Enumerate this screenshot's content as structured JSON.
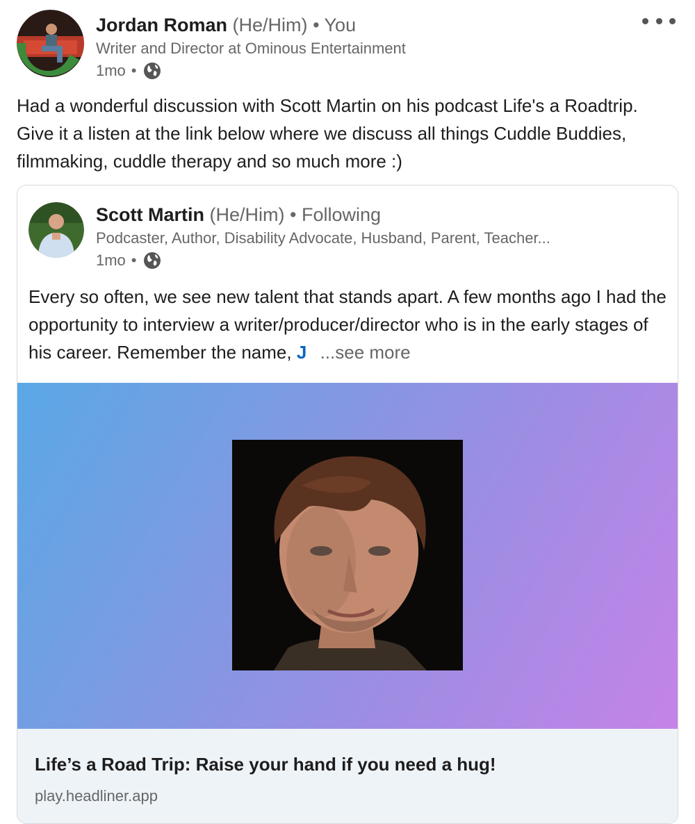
{
  "author": {
    "name": "Jordan Roman",
    "pronouns": "(He/Him)",
    "separator": "•",
    "relation": "You",
    "headline": "Writer and Director at Ominous Entertainment",
    "time": "1mo",
    "time_separator": "•",
    "visibility_icon": "globe-icon",
    "avatar_badge": "#OPENTOWORK"
  },
  "post": {
    "text": "Had a wonderful discussion with Scott Martin on his podcast Life's a Roadtrip. Give it a listen at the link below where we discuss all things Cuddle Buddies, filmmaking, cuddle therapy and so much more :)"
  },
  "shared": {
    "author": {
      "name": "Scott Martin",
      "pronouns": "(He/Him)",
      "separator": "•",
      "relation": "Following",
      "headline": "Podcaster, Author, Disability Advocate, Husband, Parent, Teacher...",
      "time": "1mo",
      "time_separator": "•"
    },
    "text": "Every so often, we see new talent that stands apart. A few months ago I had the opportunity to interview a writer/producer/director who is in the early stages of his career. Remember the name,",
    "mention": "J",
    "see_more": "...see more"
  },
  "link": {
    "title": "Life’s a Road Trip: Raise your hand if you need a hug!",
    "domain": "play.headliner.app"
  },
  "colors": {
    "accent": "#0a66c2",
    "open_to_work": "#3d8b3d",
    "footer_bg": "#eef3f8"
  }
}
